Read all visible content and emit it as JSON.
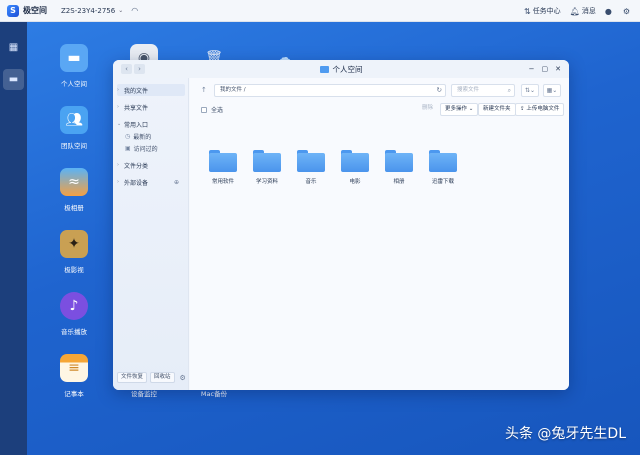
{
  "topbar": {
    "brand": "极空间",
    "device": "Z2S-23Y4-2756",
    "tasks_label": "任务中心",
    "messages_label": "消息"
  },
  "desktop": {
    "icons": [
      {
        "label": "个人空间",
        "icon": "folder-icon",
        "color": "#5aa7f4"
      },
      {
        "label": "团队空间",
        "icon": "team-folder-icon",
        "color": "#4aa3f2"
      },
      {
        "label": "极相册",
        "icon": "photo-album-icon",
        "color": "#f3a043"
      },
      {
        "label": "极影视",
        "icon": "video-icon",
        "color": "#c9a053"
      },
      {
        "label": "音乐播放",
        "icon": "music-note-icon",
        "color": "#7b4fe0"
      },
      {
        "label": "记事本",
        "icon": "notepad-icon",
        "color": "#f6a636"
      },
      {
        "label": "设备监控",
        "icon": "device-monitor-icon",
        "color": "#6c7a90"
      },
      {
        "label": "Mac备份",
        "icon": "mac-backup-icon",
        "color": "#3d6fd8"
      }
    ]
  },
  "window": {
    "title": "个人空间",
    "sidebar": {
      "items": [
        "我的文件",
        "共享文件",
        "常用入口",
        "文件分类",
        "外部设备"
      ],
      "sub_items": [
        "最新的",
        "访问过的"
      ],
      "bottom_buttons": [
        "文件恢复",
        "回收站"
      ]
    },
    "address": "我的文件 /",
    "search_placeholder": "搜索文件",
    "toolbar": {
      "select_all": "全选",
      "delete": "删除",
      "more": "更多操作",
      "new_folder": "新建文件夹",
      "upload": "上传电脑文件"
    },
    "folders": [
      "常用软件",
      "学习资料",
      "音乐",
      "电影",
      "相册",
      "迅雷下载"
    ]
  },
  "watermark": "头条 @兔牙先生DL"
}
